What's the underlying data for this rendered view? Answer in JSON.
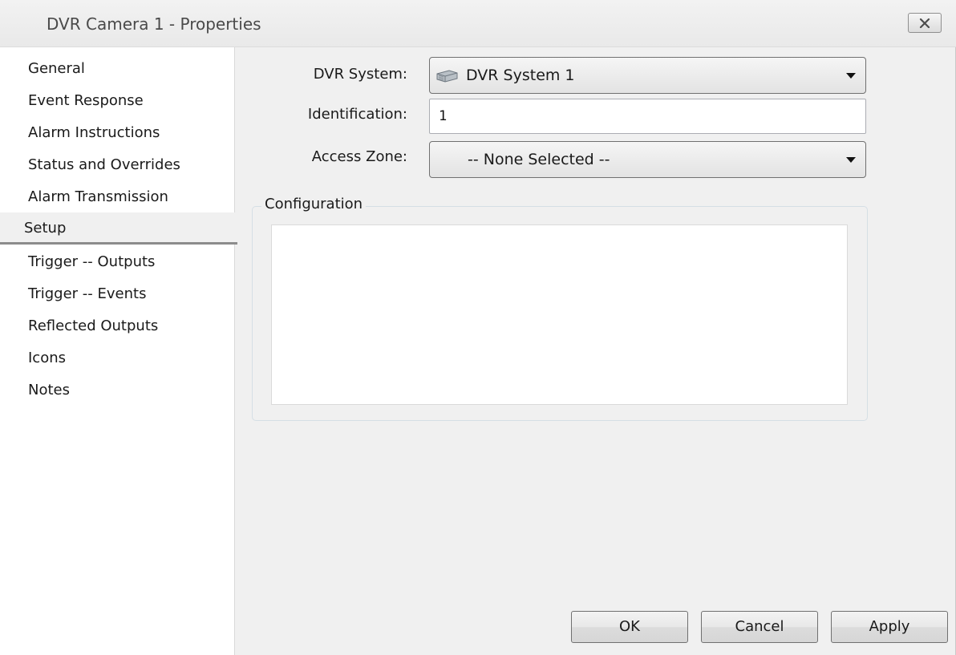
{
  "window": {
    "title": "DVR Camera 1 - Properties"
  },
  "nav": {
    "items": [
      {
        "label": "General",
        "selected": false
      },
      {
        "label": "Event Response",
        "selected": false
      },
      {
        "label": "Alarm Instructions",
        "selected": false
      },
      {
        "label": "Status and Overrides",
        "selected": false
      },
      {
        "label": "Alarm Transmission",
        "selected": false
      },
      {
        "label": "Setup",
        "selected": true
      },
      {
        "label": "Trigger -- Outputs",
        "selected": false
      },
      {
        "label": "Trigger -- Events",
        "selected": false
      },
      {
        "label": "Reflected Outputs",
        "selected": false
      },
      {
        "label": "Icons",
        "selected": false
      },
      {
        "label": "Notes",
        "selected": false
      }
    ]
  },
  "form": {
    "dvr_system": {
      "label": "DVR System:",
      "value": "DVR System 1",
      "icon": "dvr-device-icon"
    },
    "identification": {
      "label": "Identification:",
      "value": "1"
    },
    "access_zone": {
      "label": "Access Zone:",
      "value": "-- None Selected --"
    },
    "configuration": {
      "legend": "Configuration"
    }
  },
  "buttons": {
    "ok": "OK",
    "cancel": "Cancel",
    "apply": "Apply"
  },
  "icons": {
    "close": "close-icon",
    "dropdown": "chevron-down-icon"
  },
  "colors": {
    "window_bg": "#f0f0f0",
    "nav_bg": "#ffffff",
    "selected_underline": "#8c8c8c"
  }
}
